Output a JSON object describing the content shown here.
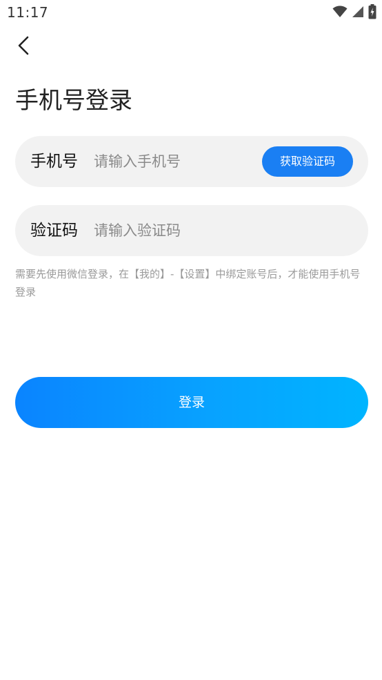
{
  "status_bar": {
    "time": "11:17",
    "icons": [
      "wifi-icon",
      "signal-icon",
      "battery-icon"
    ]
  },
  "header": {
    "back_icon": "chevron-left-icon",
    "title": "手机号登录"
  },
  "form": {
    "phone": {
      "label": "手机号",
      "placeholder": "请输入手机号",
      "value": "",
      "get_code_label": "获取验证码"
    },
    "code": {
      "label": "验证码",
      "placeholder": "请输入验证码",
      "value": ""
    },
    "hint": "需要先使用微信登录，在【我的】-【设置】中绑定账号后，才能使用手机号登录"
  },
  "actions": {
    "login_label": "登录"
  },
  "colors": {
    "accent": "#1a7ff3",
    "gradient_start": "#0a84ff",
    "gradient_end": "#00b4ff",
    "field_background": "#f2f2f2",
    "hint_text": "#9a9a9a"
  }
}
